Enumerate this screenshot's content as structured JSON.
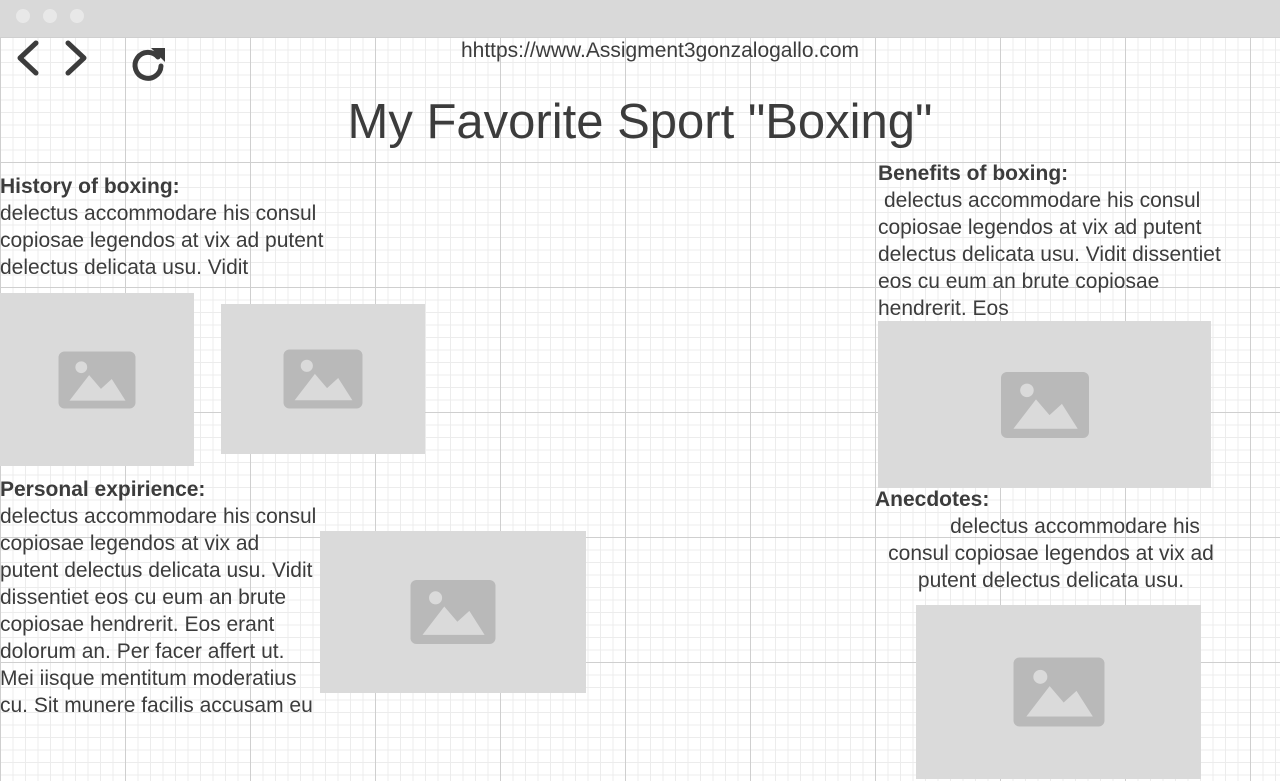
{
  "browser": {
    "url": "hhttps://www.Assigment3gonzalogallo.com",
    "back_icon": "chevron-left-icon",
    "forward_icon": "chevron-right-icon",
    "reload_icon": "reload-icon"
  },
  "page": {
    "title": "My Favorite Sport \"Boxing\""
  },
  "sections": {
    "history": {
      "heading": "History of boxing:",
      "body": "delectus accommodare his consul copiosae legendos at vix ad putent delectus delicata usu. Vidit"
    },
    "benefits": {
      "heading": "Benefits of boxing:",
      "body": "delectus accommodare his consul copiosae legendos at vix ad putent delectus delicata usu. Vidit dissentiet eos cu eum an brute copiosae hendrerit. Eos"
    },
    "personal": {
      "heading": "Personal expirience:",
      "body": "delectus accommodare his consul copiosae legendos at vix ad putent delectus delicata usu. Vidit dissentiet eos cu eum an brute copiosae hendrerit. Eos erant dolorum an. Per facer affert ut. Mei iisque mentitum moderatius cu. Sit munere facilis accusam eu"
    },
    "anecdotes": {
      "heading": "Anecdotes:",
      "body": "delectus accommodare his consul copiosae legendos at vix ad putent delectus delicata usu."
    }
  },
  "colors": {
    "titlebar": "#d9d9d9",
    "placeholder": "#dadada",
    "placeholder_icon": "#b9b9b9",
    "text": "#3c3c3c"
  }
}
